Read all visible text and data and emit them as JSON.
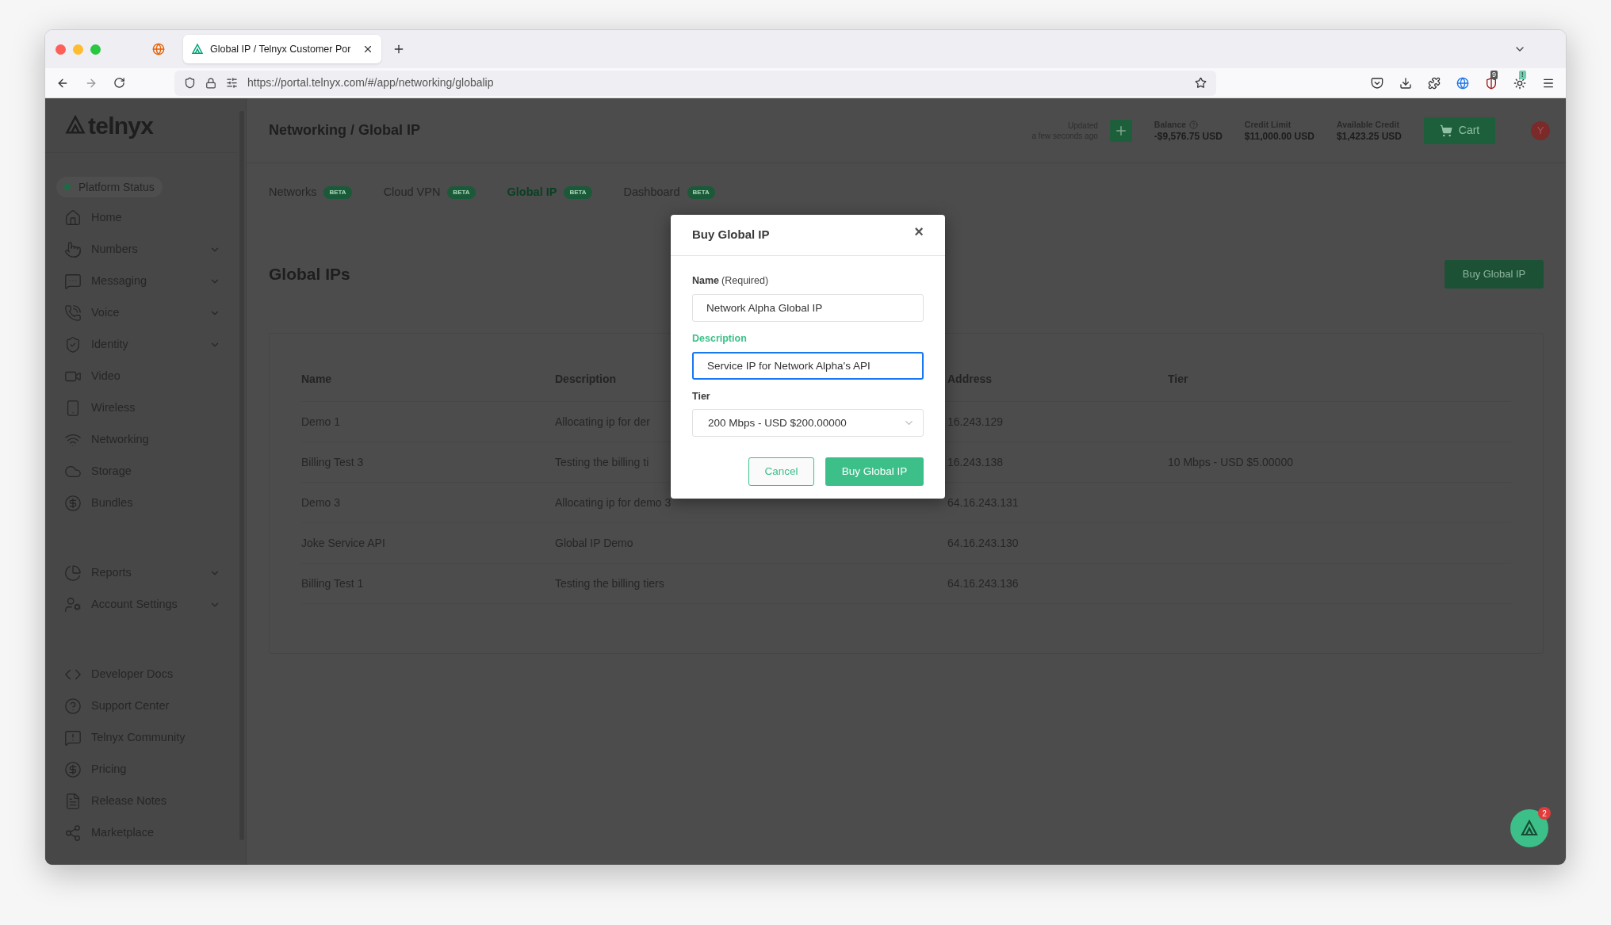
{
  "browser": {
    "tab_title": "Global IP / Telnyx Customer Por",
    "url": "https://portal.telnyx.com/#/app/networking/globalip",
    "extension_badges": [
      "9",
      "!"
    ]
  },
  "sidebar": {
    "logo": "telnyx",
    "status": {
      "label": "Platform Status",
      "color": "#1c6b45"
    },
    "sections": [
      [
        {
          "label": "Home",
          "has_submenu": false
        },
        {
          "label": "Numbers",
          "has_submenu": true
        },
        {
          "label": "Messaging",
          "has_submenu": true
        },
        {
          "label": "Voice",
          "has_submenu": true
        },
        {
          "label": "Identity",
          "has_submenu": true
        },
        {
          "label": "Video",
          "has_submenu": false
        },
        {
          "label": "Wireless",
          "has_submenu": false
        },
        {
          "label": "Networking",
          "has_submenu": false
        },
        {
          "label": "Storage",
          "has_submenu": false
        },
        {
          "label": "Bundles",
          "has_submenu": false
        }
      ],
      [
        {
          "label": "Reports",
          "has_submenu": true
        },
        {
          "label": "Account Settings",
          "has_submenu": true
        }
      ],
      [
        {
          "label": "Developer Docs",
          "has_submenu": false
        },
        {
          "label": "Support Center",
          "has_submenu": false
        },
        {
          "label": "Telnyx Community",
          "has_submenu": false
        },
        {
          "label": "Pricing",
          "has_submenu": false
        },
        {
          "label": "Release Notes",
          "has_submenu": false
        },
        {
          "label": "Marketplace",
          "has_submenu": false
        }
      ]
    ]
  },
  "header": {
    "breadcrumb": "Networking / Global IP",
    "updated": [
      "Updated",
      "a few seconds ago"
    ],
    "stats": [
      {
        "label": "Balance",
        "value": "-$9,576.75 USD",
        "help": true
      },
      {
        "label": "Credit Limit",
        "value": "$11,000.00 USD",
        "help": false
      },
      {
        "label": "Available Credit",
        "value": "$1,423.25 USD",
        "help": false
      }
    ],
    "cart": "Cart",
    "avatar": "Y"
  },
  "tabs": [
    {
      "label": "Networks",
      "badge": "BETA",
      "selected": false
    },
    {
      "label": "Cloud VPN",
      "badge": "BETA",
      "selected": false
    },
    {
      "label": "Global IP",
      "badge": "BETA",
      "selected": true
    },
    {
      "label": "Dashboard",
      "badge": "BETA",
      "selected": false
    }
  ],
  "page": {
    "title": "Global IPs",
    "buy_button": "Buy Global IP"
  },
  "table": {
    "columns": [
      "Name",
      "Description",
      "Address",
      "Tier"
    ],
    "rows": [
      [
        "Demo 1",
        "Allocating ip for der",
        "16.243.129",
        ""
      ],
      [
        "Billing Test 3",
        "Testing the billing ti",
        "16.243.138",
        "10 Mbps - USD $5.00000"
      ],
      [
        "Demo 3",
        "Allocating ip for demo 3",
        "64.16.243.131",
        ""
      ],
      [
        "Joke Service API",
        "Global IP Demo",
        "64.16.243.130",
        ""
      ],
      [
        "Billing Test 1",
        "Testing the billing tiers",
        "64.16.243.136",
        ""
      ]
    ]
  },
  "modal": {
    "title": "Buy Global IP",
    "close": "×",
    "fields": [
      {
        "kind": "text",
        "label": "Name",
        "hint": "(Required)",
        "value": "Network Alpha Global IP",
        "focused": false
      },
      {
        "kind": "text",
        "label": "Description",
        "value": "Service IP for Network Alpha's API",
        "focused": true
      },
      {
        "kind": "select",
        "label": "Tier",
        "value": "200 Mbps - USD $200.00000"
      }
    ],
    "cancel": "Cancel",
    "submit": "Buy Global IP"
  },
  "chat_badge": "2"
}
